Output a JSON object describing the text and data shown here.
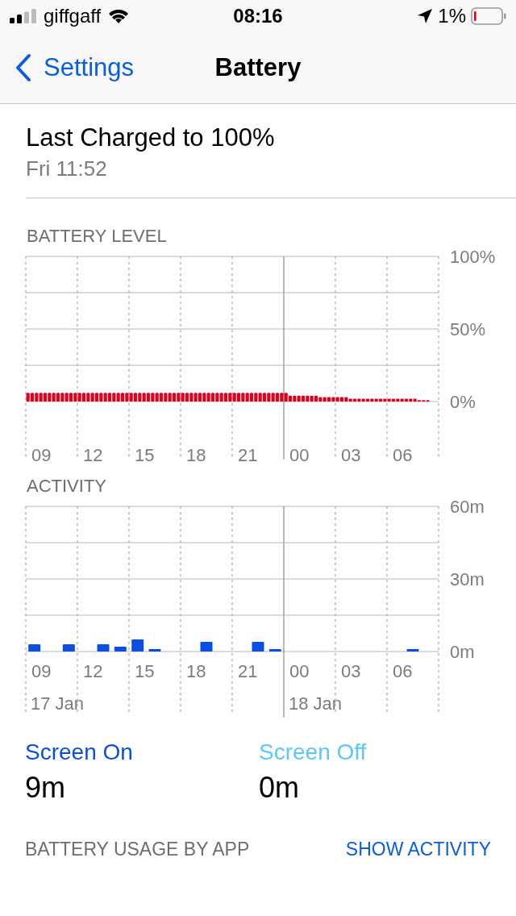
{
  "status_bar": {
    "carrier": "giffgaff",
    "time": "08:16",
    "battery_percent": "1%"
  },
  "nav": {
    "back": "Settings",
    "title": "Battery"
  },
  "last_charged": {
    "title": "Last Charged to 100%",
    "time": "Fri 11:52"
  },
  "battery_level": {
    "chart_data": {
      "type": "bar",
      "title": "BATTERY LEVEL",
      "ylim": [
        0,
        100
      ],
      "yticks": [
        {
          "value": 0,
          "label": "0%"
        },
        {
          "value": 50,
          "label": "50%"
        },
        {
          "value": 100,
          "label": "100%"
        }
      ],
      "categories": [
        null,
        null,
        null,
        "09",
        null,
        null,
        null,
        null,
        null,
        null,
        null,
        null,
        null,
        null,
        null,
        "12",
        null,
        null,
        null,
        null,
        null,
        null,
        null,
        null,
        null,
        null,
        null,
        "15",
        null,
        null,
        null,
        null,
        null,
        null,
        null,
        null,
        null,
        null,
        null,
        "18",
        null,
        null,
        null,
        null,
        null,
        null,
        null,
        null,
        null,
        null,
        null,
        "21",
        null,
        null,
        null,
        null,
        null,
        null,
        null,
        null,
        null,
        null,
        null,
        "00",
        null,
        null,
        null,
        null,
        null,
        null,
        null,
        null,
        null,
        null,
        null,
        "03",
        null,
        null,
        null,
        null,
        null,
        null,
        null,
        null,
        null,
        null,
        null,
        "06",
        null,
        null,
        null,
        null,
        null,
        null,
        null,
        null
      ],
      "grid": true,
      "series": [
        {
          "color": "#e0001b",
          "values": [
            6,
            6,
            6,
            6,
            6,
            6,
            6,
            6,
            6,
            6,
            6,
            6,
            6,
            6,
            6,
            6,
            6,
            6,
            6,
            6,
            6,
            6,
            6,
            6,
            6,
            6,
            6,
            6,
            6,
            6,
            6,
            6,
            6,
            6,
            6,
            6,
            6,
            6,
            6,
            6,
            6,
            6,
            6,
            6,
            6,
            6,
            6,
            6,
            6,
            6,
            6,
            6,
            6,
            6,
            6,
            6,
            6,
            6,
            6,
            6,
            6,
            4,
            4,
            4,
            4,
            4,
            4,
            4,
            3,
            3,
            3,
            3,
            3,
            3,
            3,
            2,
            2,
            2,
            2,
            2,
            2,
            2,
            2,
            2,
            2,
            2,
            2,
            2,
            2,
            2,
            2,
            1,
            1,
            1,
            null,
            null
          ]
        }
      ]
    }
  },
  "activity": {
    "chart_data": {
      "type": "bar",
      "title": "ACTIVITY",
      "ylim": [
        0,
        60
      ],
      "yticks": [
        {
          "value": 0,
          "label": "0m"
        },
        {
          "value": 30,
          "label": "30m"
        },
        {
          "value": 60,
          "label": "60m"
        }
      ],
      "grid": true,
      "categories": [
        "09",
        null,
        null,
        "12",
        null,
        null,
        "15",
        null,
        null,
        "18",
        null,
        null,
        "21",
        null,
        null,
        "00",
        null,
        null,
        "03",
        null,
        null,
        "06",
        null,
        null
      ],
      "series": [
        {
          "name": "Screen On",
          "color": "#0a4fe0",
          "values": [
            3,
            0,
            3,
            0,
            3,
            2,
            5,
            1,
            0,
            0,
            4,
            0,
            0,
            4,
            1,
            0,
            0,
            0,
            0,
            0,
            0,
            0,
            1,
            0
          ]
        },
        {
          "name": "Screen Off",
          "color": "#5ac8fa",
          "values": [
            0,
            0,
            0,
            0,
            0,
            0,
            0,
            0,
            0,
            0,
            0,
            0,
            0,
            0,
            0,
            0,
            0,
            0,
            0,
            0,
            0,
            0,
            0,
            0
          ]
        }
      ]
    },
    "dates": [
      "17 Jan",
      "18 Jan"
    ]
  },
  "legend": [
    {
      "value": "9m"
    },
    {
      "value": "0m"
    }
  ],
  "usage": {
    "header": "BATTERY USAGE BY APP",
    "action": "SHOW ACTIVITY"
  }
}
